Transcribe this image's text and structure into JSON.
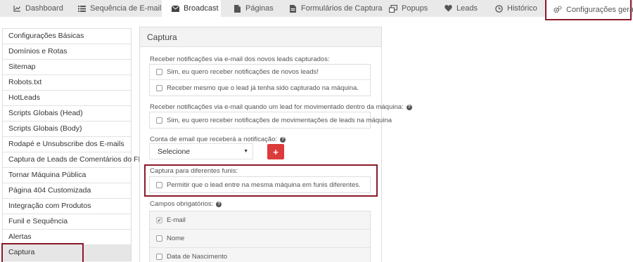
{
  "nav": {
    "tabs": [
      {
        "label": "Dashboard",
        "icon": "area-chart-icon"
      },
      {
        "label": "Sequência de E-mails",
        "icon": "list-icon"
      },
      {
        "label": "Broadcast",
        "icon": "envelope-icon"
      },
      {
        "label": "Páginas",
        "icon": "file-icon"
      },
      {
        "label": "Formulários de Captura",
        "icon": "file-text-icon"
      },
      {
        "label": "Popups",
        "icon": "popup-icon"
      },
      {
        "label": "Leads",
        "icon": "heart-icon"
      },
      {
        "label": "Histórico",
        "icon": "clock-icon"
      },
      {
        "label": "Configurações gerais",
        "icon": "gears-icon"
      }
    ]
  },
  "sidebar": {
    "items": [
      "Configurações Básicas",
      "Domínios e Rotas",
      "Sitemap",
      "Robots.txt",
      "HotLeads",
      "Scripts Globais (Head)",
      "Scripts Globais (Body)",
      "Rodapé e Unsubscribe dos E-mails",
      "Captura de Leads de Comentários do FB",
      "Tornar Máquina Pública",
      "Página 404 Customizada",
      "Integração com Produtos",
      "Funil e Sequência",
      "Alertas",
      "Captura"
    ]
  },
  "panel": {
    "title": "Captura",
    "notify_new": {
      "label": "Receber notificações via e-mail dos novos leads capturados:",
      "opt1": "Sim, eu quero receber notificações de novos leads!",
      "opt2": "Receber mesmo que o lead já tenha sido capturado na máquina."
    },
    "notify_move": {
      "label": "Receber notificações via e-mail quando um lead for movimentado dentro da máquina:",
      "opt1": "Sim, eu quero receber notificações de movimentações de leads na máquina"
    },
    "email_account": {
      "label": "Conta de email que receberá a notificação:",
      "select_value": "Selecione",
      "add_label": "+"
    },
    "funnels": {
      "label": "Captura para diferentes funis:",
      "opt1": "Permitir que o lead entre na mesma máquina em funis diferentes."
    },
    "required": {
      "label": "Campos obrigatórios:",
      "fields": [
        "E-mail",
        "Nome",
        "Data de Nascimento"
      ]
    }
  },
  "colors": {
    "highlight": "#8b1a2a",
    "add_button": "#dc3b3b"
  }
}
